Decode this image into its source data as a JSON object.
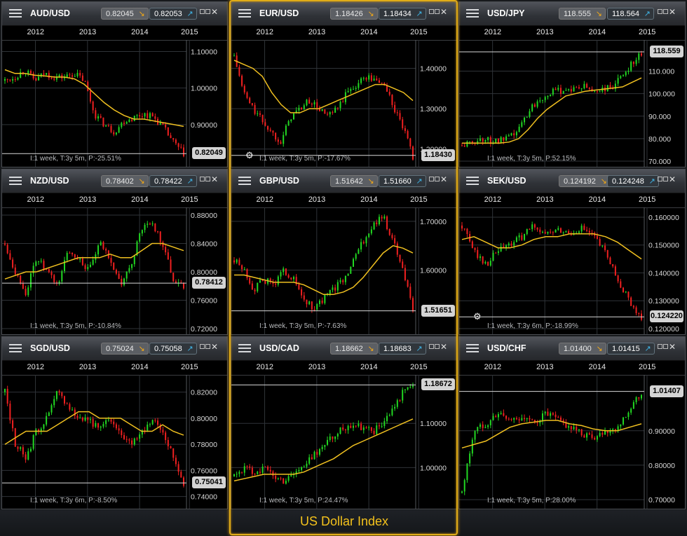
{
  "footer": {
    "label": "US Dollar Index"
  },
  "years": [
    "2012",
    "2013",
    "2014",
    "2015"
  ],
  "panels": [
    {
      "pair": "AUD/USD",
      "bid": "0.82045",
      "bid_dir": "down",
      "ask": "0.82053",
      "ask_dir": "up",
      "info": "I:1 week, T:3y 5m, P:-25.51%",
      "price_label": "0.82049",
      "price_value": 0.82049,
      "axis_labels": [
        "1.10000",
        "1.00000",
        "0.90000"
      ],
      "axis_values": [
        1.1,
        1.0,
        0.9
      ],
      "ymin": 0.8,
      "ymax": 1.12,
      "gear": false,
      "chart_data": {
        "type": "candlestick",
        "close": [
          1.02,
          1.03,
          1.05,
          1.02,
          1.04,
          1.03,
          1.03,
          1.04,
          1.02,
          0.93,
          0.9,
          0.88,
          0.91,
          0.92,
          0.93,
          0.92,
          0.89,
          0.85,
          0.82
        ],
        "moving_average": [
          1.05,
          1.04,
          1.04,
          1.035,
          1.033,
          1.03,
          1.03,
          1.025,
          1.01,
          0.985,
          0.96,
          0.94,
          0.925,
          0.915,
          0.915,
          0.91,
          0.905,
          0.9,
          0.895
        ]
      }
    },
    {
      "pair": "EUR/USD",
      "bid": "1.18426",
      "bid_dir": "down",
      "ask": "1.18434",
      "ask_dir": "up",
      "info": "I:1 week, T:3y 5m, P:-17.67%",
      "price_label": "1.18430",
      "price_value": 1.1843,
      "axis_labels": [
        "1.40000",
        "1.30000",
        "1.20000"
      ],
      "axis_values": [
        1.4,
        1.3,
        1.2
      ],
      "ymin": 1.17,
      "ymax": 1.46,
      "gear": true,
      "chart_data": {
        "type": "candlestick",
        "close": [
          1.43,
          1.34,
          1.3,
          1.27,
          1.24,
          1.22,
          1.28,
          1.3,
          1.32,
          1.3,
          1.28,
          1.3,
          1.34,
          1.36,
          1.38,
          1.37,
          1.36,
          1.3,
          1.25,
          1.18
        ],
        "moving_average": [
          1.42,
          1.41,
          1.4,
          1.38,
          1.34,
          1.31,
          1.29,
          1.29,
          1.3,
          1.3,
          1.31,
          1.32,
          1.33,
          1.34,
          1.35,
          1.36,
          1.36,
          1.35,
          1.34,
          1.32
        ]
      }
    },
    {
      "pair": "USD/JPY",
      "bid": "118.555",
      "bid_dir": "down",
      "ask": "118.564",
      "ask_dir": "up",
      "info": "I:1 week, T:3y 5m, P:52.15%",
      "price_label": "118.559",
      "price_value": 118.559,
      "axis_labels": [
        "110.000",
        "100.000",
        "90.000",
        "80.000",
        "70.000"
      ],
      "axis_values": [
        110,
        100,
        90,
        80,
        70
      ],
      "ymin": 70,
      "ymax": 122,
      "gear": false,
      "chart_data": {
        "type": "candlestick",
        "close": [
          77,
          78,
          80,
          79,
          79,
          80,
          84,
          92,
          97,
          100,
          101,
          102,
          102,
          103,
          101,
          102,
          103,
          108,
          114,
          118
        ],
        "moving_average": [
          78,
          78,
          78,
          78,
          78,
          78.5,
          80,
          84,
          89,
          93,
          96,
          99,
          100,
          101,
          101.5,
          102,
          102.5,
          103,
          105,
          107
        ]
      }
    },
    {
      "pair": "NZD/USD",
      "bid": "0.78402",
      "bid_dir": "down",
      "ask": "0.78422",
      "ask_dir": "up",
      "info": "I:1 week, T:3y 5m, P:-10.84%",
      "price_label": "0.78412",
      "price_value": 0.78412,
      "axis_labels": [
        "0.88000",
        "0.84000",
        "0.80000",
        "0.76000",
        "0.72000"
      ],
      "axis_values": [
        0.88,
        0.84,
        0.8,
        0.76,
        0.72
      ],
      "ymin": 0.72,
      "ymax": 0.885,
      "gear": false,
      "chart_data": {
        "type": "candlestick",
        "close": [
          0.84,
          0.8,
          0.77,
          0.82,
          0.8,
          0.78,
          0.83,
          0.82,
          0.8,
          0.84,
          0.82,
          0.78,
          0.81,
          0.86,
          0.87,
          0.84,
          0.79,
          0.78
        ],
        "moving_average": [
          0.79,
          0.795,
          0.8,
          0.8,
          0.805,
          0.81,
          0.815,
          0.82,
          0.82,
          0.82,
          0.825,
          0.82,
          0.82,
          0.83,
          0.84,
          0.84,
          0.835,
          0.83
        ]
      }
    },
    {
      "pair": "GBP/USD",
      "bid": "1.51642",
      "bid_dir": "down",
      "ask": "1.51660",
      "ask_dir": "up",
      "info": "I:1 week, T:3y 5m, P:-7.63%",
      "price_label": "1.51651",
      "price_value": 1.51651,
      "axis_labels": [
        "1.70000",
        "1.60000"
      ],
      "axis_values": [
        1.7,
        1.6
      ],
      "ymin": 1.48,
      "ymax": 1.72,
      "gear": false,
      "chart_data": {
        "type": "candlestick",
        "close": [
          1.62,
          1.6,
          1.56,
          1.58,
          1.57,
          1.6,
          1.58,
          1.54,
          1.52,
          1.54,
          1.56,
          1.58,
          1.62,
          1.66,
          1.69,
          1.71,
          1.66,
          1.6,
          1.52
        ],
        "moving_average": [
          1.59,
          1.59,
          1.585,
          1.58,
          1.575,
          1.575,
          1.575,
          1.57,
          1.56,
          1.55,
          1.55,
          1.555,
          1.565,
          1.585,
          1.61,
          1.635,
          1.65,
          1.645,
          1.635
        ]
      }
    },
    {
      "pair": "SEK/USD",
      "bid": "0.124192",
      "bid_dir": "down",
      "ask": "0.124248",
      "ask_dir": "up",
      "info": "I:1 week, T:3y 6m, P:-18.99%",
      "price_label": "0.124220",
      "price_value": 0.12422,
      "axis_labels": [
        "0.160000",
        "0.150000",
        "0.140000",
        "0.130000",
        "0.120000"
      ],
      "axis_values": [
        0.16,
        0.15,
        0.14,
        0.13,
        0.12
      ],
      "ymin": 0.12,
      "ymax": 0.162,
      "gear": true,
      "chart_data": {
        "type": "candlestick",
        "close": [
          0.157,
          0.148,
          0.143,
          0.148,
          0.15,
          0.153,
          0.157,
          0.154,
          0.155,
          0.154,
          0.156,
          0.153,
          0.147,
          0.138,
          0.13,
          0.124
        ],
        "moving_average": [
          0.152,
          0.153,
          0.151,
          0.149,
          0.149,
          0.15,
          0.152,
          0.153,
          0.153,
          0.154,
          0.154,
          0.154,
          0.153,
          0.151,
          0.148,
          0.145
        ]
      }
    },
    {
      "pair": "SGD/USD",
      "bid": "0.75024",
      "bid_dir": "down",
      "ask": "0.75058",
      "ask_dir": "up",
      "info": "I:1 week, T:3y 6m, P:-8.50%",
      "price_label": "0.75041",
      "price_value": 0.75041,
      "axis_labels": [
        "0.82000",
        "0.80000",
        "0.78000",
        "0.76000",
        "0.74000"
      ],
      "axis_values": [
        0.82,
        0.8,
        0.78,
        0.76,
        0.74
      ],
      "ymin": 0.735,
      "ymax": 0.83,
      "gear": false,
      "chart_data": {
        "type": "candlestick",
        "close": [
          0.82,
          0.78,
          0.77,
          0.79,
          0.8,
          0.82,
          0.81,
          0.8,
          0.8,
          0.79,
          0.8,
          0.79,
          0.78,
          0.79,
          0.8,
          0.79,
          0.77,
          0.75
        ],
        "moving_average": [
          0.78,
          0.785,
          0.79,
          0.79,
          0.79,
          0.795,
          0.8,
          0.805,
          0.805,
          0.8,
          0.8,
          0.8,
          0.795,
          0.79,
          0.79,
          0.795,
          0.79,
          0.787
        ]
      }
    },
    {
      "pair": "USD/CAD",
      "bid": "1.18662",
      "bid_dir": "down",
      "ask": "1.18683",
      "ask_dir": "up",
      "info": "I:1 week, T:3y 5m, P:24.47%",
      "price_label": "1.18672",
      "price_value": 1.18672,
      "axis_labels": [
        "1.10000",
        "1.00000"
      ],
      "axis_values": [
        1.1,
        1.0
      ],
      "ymin": 0.92,
      "ymax": 1.2,
      "gear": false,
      "chart_data": {
        "type": "candlestick",
        "close": [
          0.98,
          1.0,
          0.99,
          1.0,
          0.98,
          0.97,
          0.99,
          1.0,
          1.03,
          1.05,
          1.07,
          1.09,
          1.1,
          1.09,
          1.08,
          1.1,
          1.13,
          1.17,
          1.19
        ],
        "moving_average": [
          0.97,
          0.975,
          0.98,
          0.985,
          0.985,
          0.985,
          0.985,
          0.99,
          1.0,
          1.01,
          1.02,
          1.035,
          1.05,
          1.06,
          1.07,
          1.08,
          1.09,
          1.1,
          1.11
        ]
      }
    },
    {
      "pair": "USD/CHF",
      "bid": "1.01400",
      "bid_dir": "down",
      "ask": "1.01415",
      "ask_dir": "up",
      "info": "I:1 week, T:3y 5m, P:28.00%",
      "price_label": "1.01407",
      "price_value": 1.01407,
      "axis_labels": [
        "0.90000",
        "0.80000",
        "0.70000"
      ],
      "axis_values": [
        0.9,
        0.8,
        0.7
      ],
      "ymin": 0.69,
      "ymax": 1.05,
      "gear": false,
      "chart_data": {
        "type": "candlestick",
        "close": [
          0.72,
          0.9,
          0.92,
          0.95,
          0.93,
          0.94,
          0.92,
          0.95,
          0.93,
          0.91,
          0.89,
          0.88,
          0.9,
          0.91,
          0.96,
          1.01
        ],
        "moving_average": [
          0.85,
          0.86,
          0.87,
          0.89,
          0.91,
          0.92,
          0.925,
          0.93,
          0.93,
          0.92,
          0.915,
          0.905,
          0.9,
          0.9,
          0.91,
          0.92
        ]
      }
    }
  ]
}
